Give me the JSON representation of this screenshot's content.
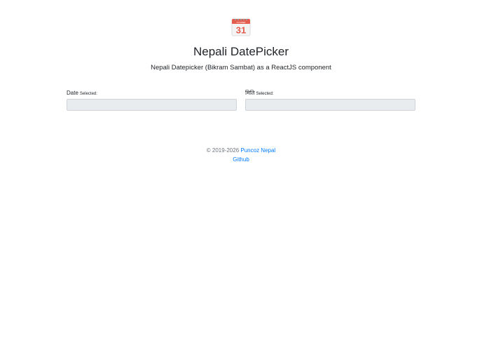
{
  "header": {
    "icon": "calendar-icon",
    "icon_month": "OCTOBER",
    "icon_day": "31",
    "title": "Nepali DatePicker",
    "subtitle": "Nepali Datepicker (Bikram Sambat) as a ReactJS component"
  },
  "fields": [
    {
      "label": "Date",
      "suffix": "Selected:",
      "value": ""
    },
    {
      "label": "मिति",
      "suffix": "Selected:",
      "value": ""
    }
  ],
  "footer": {
    "copyright": "© 2019-2026",
    "author_link": "Puncoz Nepal",
    "github_link": "Github"
  },
  "colors": {
    "link": "#007bff",
    "input_bg": "#e9ecef",
    "icon_red": "#e74c3c"
  }
}
